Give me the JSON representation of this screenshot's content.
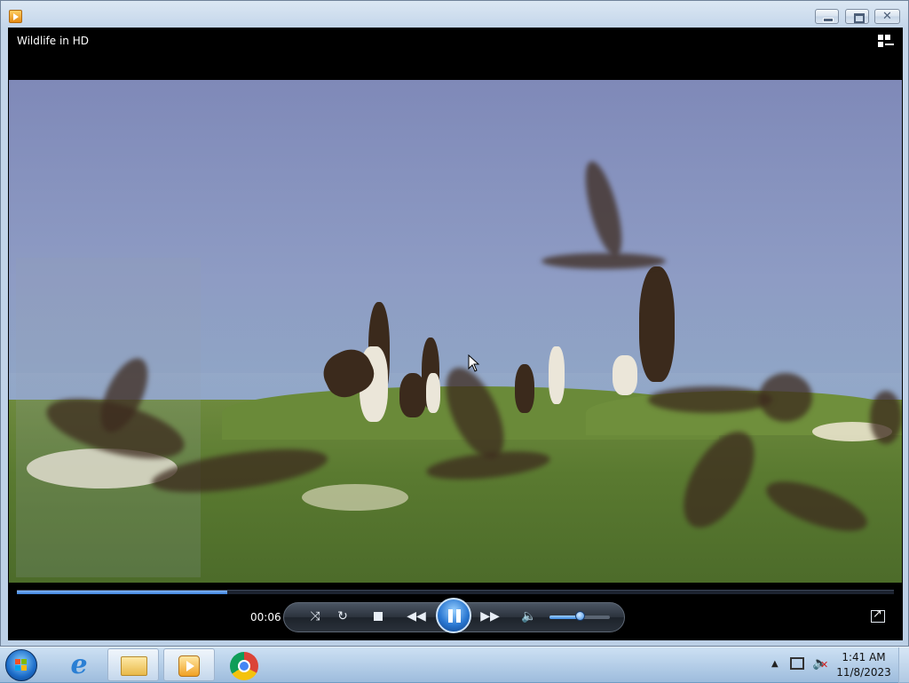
{
  "window": {
    "title": "",
    "icon": "windows-media-player-icon"
  },
  "player": {
    "media_title": "Wildlife in HD",
    "elapsed_time": "00:06",
    "progress_fraction": 0.24,
    "volume_fraction": 0.5,
    "state": "playing",
    "controls": {
      "shuffle": "shuffle-icon",
      "repeat": "repeat-icon",
      "stop": "stop-icon",
      "previous": "rewind-icon",
      "play_pause": "pause-icon",
      "next": "fast-forward-icon",
      "mute": "speaker-icon",
      "fullscreen": "switch-to-full-mode-icon",
      "view": "switch-to-library-icon"
    }
  },
  "taskbar": {
    "pinned": [
      "internet-explorer",
      "windows-explorer",
      "windows-media-player",
      "google-chrome"
    ],
    "clock_time": "1:41 AM",
    "clock_date": "11/8/2023"
  },
  "colors": {
    "player_background": "#000000",
    "seek_fill": "#3c7fd8",
    "play_button": "#2a78d2",
    "taskbar": "#b7cfe8"
  }
}
